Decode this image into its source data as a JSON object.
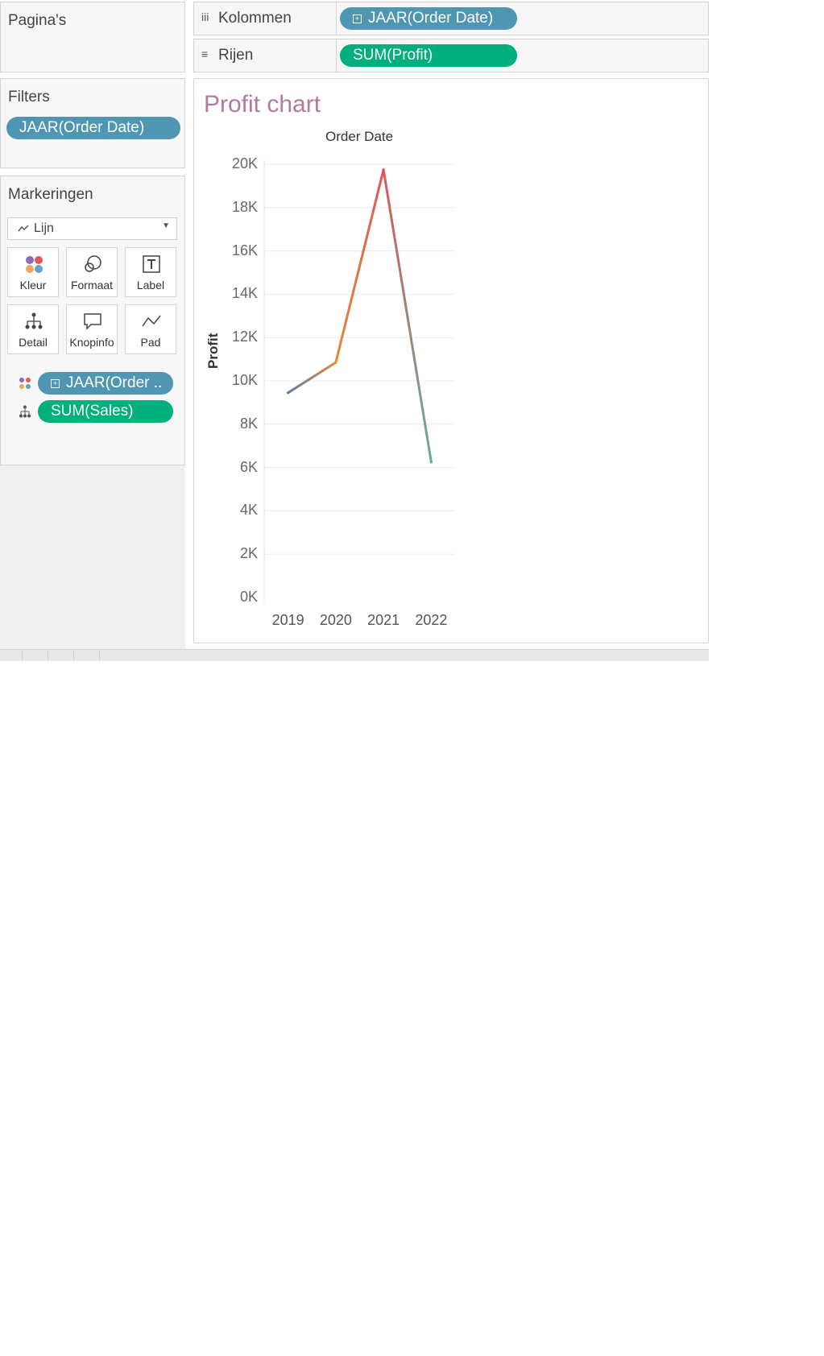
{
  "pages": {
    "title": "Pagina's"
  },
  "shelves": {
    "columns": {
      "label": "Kolommen",
      "icon": "columns-icon",
      "pill": "JAAR(Order Date)"
    },
    "rows": {
      "label": "Rijen",
      "icon": "rows-icon",
      "pill": "SUM(Profit)"
    }
  },
  "filters": {
    "title": "Filters",
    "pill": "JAAR(Order Date)"
  },
  "marks": {
    "title": "Markeringen",
    "mark_type": "Lijn",
    "cards": [
      {
        "label": "Kleur",
        "icon": "color-icon"
      },
      {
        "label": "Formaat",
        "icon": "size-icon"
      },
      {
        "label": "Label",
        "icon": "label-icon"
      },
      {
        "label": "Detail",
        "icon": "detail-icon"
      },
      {
        "label": "Knopinfo",
        "icon": "tooltip-icon"
      },
      {
        "label": "Pad",
        "icon": "path-icon"
      }
    ],
    "fields": [
      {
        "icon": "color-icon",
        "pill": "JAAR(Order .."
      },
      {
        "icon": "detail-icon",
        "pill": "SUM(Sales)"
      }
    ]
  },
  "colors": {
    "blue_pill": "#4f96b3",
    "green_pill": "#00b07c",
    "title": "#b07aa1"
  },
  "chart_data": {
    "type": "line",
    "title": "Profit chart",
    "x_header": "Order Date",
    "ylabel": "Profit",
    "categories": [
      "2019",
      "2020",
      "2021",
      "2022"
    ],
    "values": [
      9450,
      10850,
      19750,
      6250
    ],
    "ylim": [
      0,
      20000
    ],
    "yticks": [
      "0K",
      "2K",
      "4K",
      "6K",
      "8K",
      "10K",
      "12K",
      "14K",
      "16K",
      "18K",
      "20K"
    ],
    "ytick_values": [
      0,
      2000,
      4000,
      6000,
      8000,
      10000,
      12000,
      14000,
      16000,
      18000,
      20000
    ],
    "grid": true,
    "segment_colors": [
      "#5b7fa6",
      "#e8893a",
      "#d85858",
      "#6aab9c"
    ]
  }
}
